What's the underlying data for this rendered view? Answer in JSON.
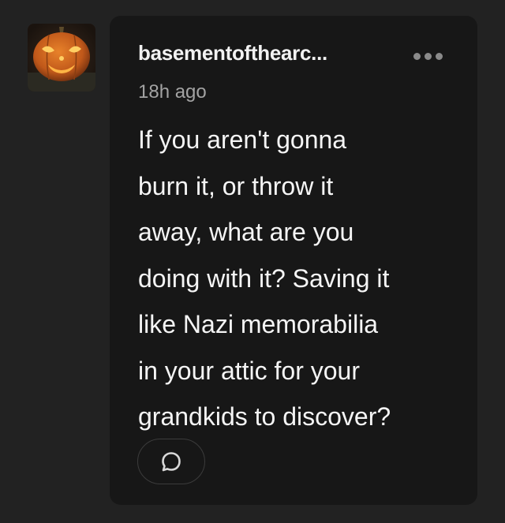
{
  "post": {
    "username": "basementofthearc...",
    "timestamp": "18h ago",
    "body_lines": [
      "If you aren't gonna",
      "burn it, or throw it",
      "away, what are you",
      "doing with it? Saving it",
      "like Nazi memorabilia",
      "in your attic for your",
      "grandkids to discover?"
    ],
    "more_icon": "more-horizontal-icon",
    "reply_icon": "speech-bubble-icon"
  },
  "colors": {
    "page_background": "#222222",
    "card_background": "#171717",
    "text_primary": "#f5f5f5",
    "text_secondary": "#a3a3a3"
  }
}
